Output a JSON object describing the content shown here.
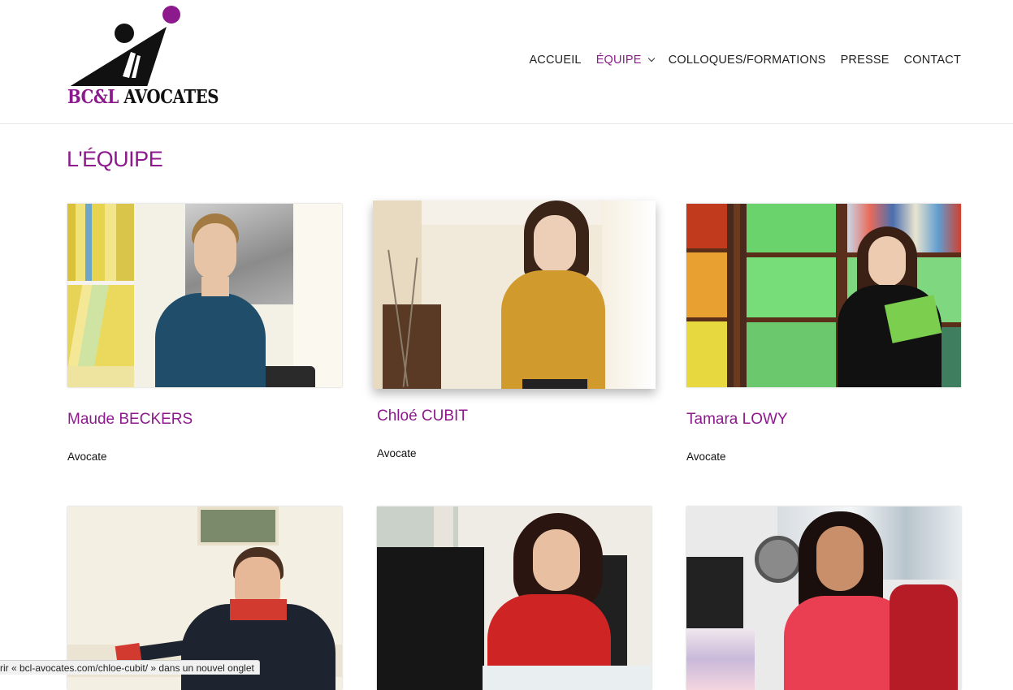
{
  "header": {
    "logo": {
      "text_part1": "BC",
      "text_part2": "&L",
      "text_part3": "AVOCATES",
      "colors": {
        "accent": "#8c1a8c",
        "dark": "#111111"
      }
    },
    "nav": {
      "items": [
        {
          "label": "ACCUEIL",
          "active": false
        },
        {
          "label": "ÉQUIPE",
          "active": true,
          "has_dropdown": true
        },
        {
          "label": "COLLOQUES/FORMATIONS",
          "active": false
        },
        {
          "label": "PRESSE",
          "active": false
        },
        {
          "label": "CONTACT",
          "active": false
        }
      ]
    }
  },
  "main": {
    "title": "L'ÉQUIPE",
    "team": [
      {
        "name": "Maude BECKERS",
        "role": "Avocate"
      },
      {
        "name": "Chloé CUBIT",
        "role": "Avocate"
      },
      {
        "name": "Tamara LOWY",
        "role": "Avocate"
      },
      {
        "name": "",
        "role": ""
      },
      {
        "name": "",
        "role": ""
      },
      {
        "name": "",
        "role": ""
      }
    ]
  },
  "status_bar": {
    "text_prefix": "rir « ",
    "url": "bcl-avocates.com/chloe-cubit/",
    "text_suffix": " » dans un nouvel onglet"
  },
  "theme": {
    "accent": "#8c1a8c",
    "text": "#222222",
    "background": "#ffffff"
  }
}
